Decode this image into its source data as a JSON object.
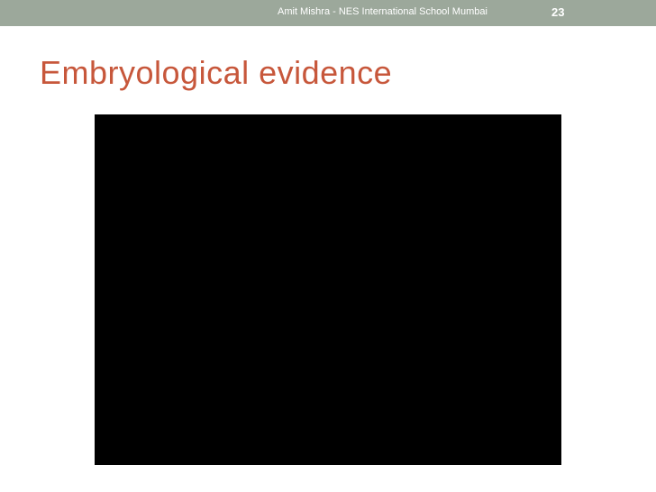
{
  "header": {
    "footer_text": "Amit Mishra - NES International School Mumbai",
    "slide_number": "23"
  },
  "slide": {
    "title": "Embryological evidence"
  },
  "colors": {
    "header_bar": "#9ca89b",
    "title": "#c7573b",
    "media_background": "#000000"
  }
}
